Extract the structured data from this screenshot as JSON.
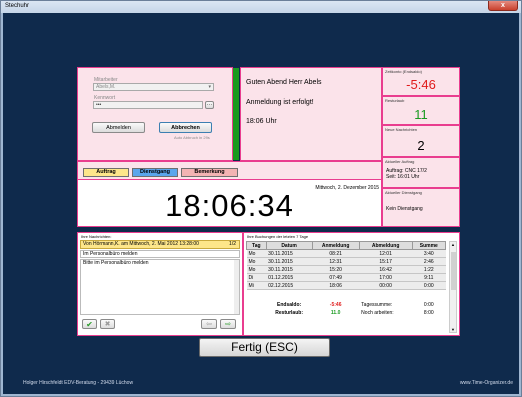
{
  "window": {
    "title": "Stechuhr",
    "close_label": "x"
  },
  "login": {
    "employee_label": "Mitarbeiter",
    "employee_value": "Abels,M.",
    "password_label": "Kennwort",
    "password_value": "•••",
    "logout_label": "Abmelden",
    "cancel_label": "Abbrechen",
    "auto_cancel_note": "Auto Abbruch in 29s"
  },
  "welcome": {
    "greeting": "Guten Abend Herr Abels",
    "status": "Anmeldung ist erfolgt!",
    "time": "18:06 Uhr"
  },
  "time_account": {
    "caption": "Zeitkonto (Endsaldo)",
    "value": "-5:46",
    "color": "#e01b1b"
  },
  "vacation_left": {
    "caption": "Resturlaub",
    "value": "11",
    "color": "#199a1f"
  },
  "new_messages": {
    "caption": "Neue Nachrichten",
    "value": "2"
  },
  "current_order": {
    "caption": "Aktueller Auftrag",
    "line1": "Auftrag: CNC 17/2",
    "line2": "Seit: 16:01 Uhr"
  },
  "current_trip": {
    "caption": "Aktueller Dienstgang",
    "value": "Kein Dienstgang"
  },
  "tabs": [
    {
      "label": "Auftrag",
      "color": "#fde68a"
    },
    {
      "label": "Dienstgang",
      "color": "#5aa6ec"
    },
    {
      "label": "Bemerkung",
      "color": "#f3b3b3"
    }
  ],
  "clock": {
    "date": "Mittwoch, 2. Dezember 2015",
    "time": "18:06:34"
  },
  "messages": {
    "caption": "Ihre Nachrichten:",
    "header": "Von Hörmann,K. am Mittwoch, 2. Mai 2012 13:28:00",
    "page": "1/2",
    "lines": [
      "Im Personalbüro melden",
      "Bitte im Personalbüro melden"
    ]
  },
  "bookings": {
    "caption": "Ihre Buchungen der letzten 7 Tage",
    "columns": [
      "Tag",
      "Datum",
      "Anmeldung",
      "Abmeldung",
      "Summe"
    ],
    "rows": [
      [
        "Mo",
        "30.11.2015",
        "08:21",
        "12:01",
        "3:40"
      ],
      [
        "Mo",
        "30.11.2015",
        "12:31",
        "15:17",
        "2:46"
      ],
      [
        "Mo",
        "30.11.2015",
        "15:20",
        "16:42",
        "1:22"
      ],
      [
        "Di",
        "01.12.2015",
        "07:49",
        "17:00",
        "9:11"
      ],
      [
        "Mi",
        "02.12.2015",
        "18:06",
        "00:00",
        "0:00"
      ]
    ],
    "end_balance_label": "Endsaldo:",
    "end_balance_value": "-5:46",
    "day_sum_label": "Tagessumme:",
    "day_sum_value": "0:00",
    "vacation_label": "Resturlaub:",
    "vacation_value": "11.0",
    "still_work_label": "Noch arbeiten:",
    "still_work_value": "8:00"
  },
  "finish_button": "Fertig   (ESC)",
  "footer": {
    "left": "Holger Hirschfeldt EDV-Beratung - 29439 Lüchow",
    "right": "www.Time-Organizer.de"
  }
}
